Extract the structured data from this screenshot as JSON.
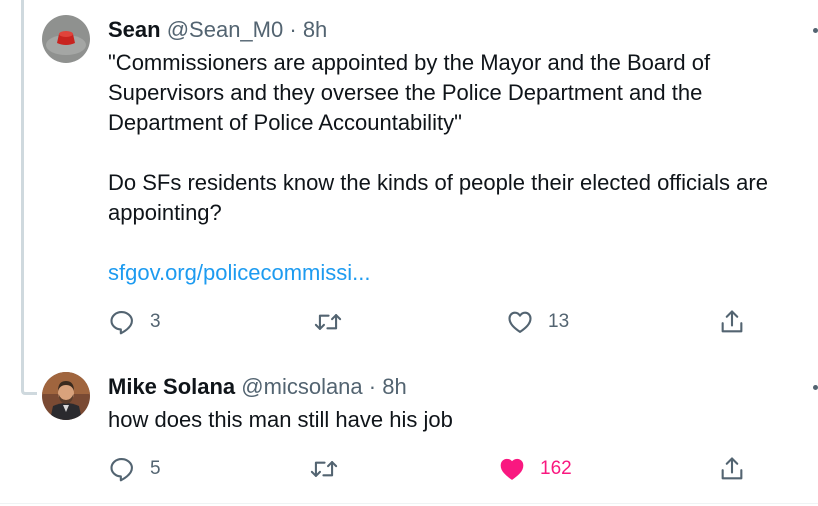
{
  "tweets": [
    {
      "display_name": "Sean",
      "handle": "@Sean_M0",
      "separator": "·",
      "time": "8h",
      "text_1": "\"Commissioners are appointed by the Mayor and the Board of Supervisors and they oversee the Police Department and the Department of Police Accountability\"",
      "text_2": "Do SFs residents know the kinds of people their elected officials are appointing?",
      "link": "sfgov.org/policecommissi...",
      "reply_count": "3",
      "retweet_count": "",
      "like_count": "13",
      "liked": false
    },
    {
      "display_name": "Mike Solana",
      "handle": "@micsolana",
      "separator": "·",
      "time": "8h",
      "text_1": "how does this man still have his job",
      "reply_count": "5",
      "retweet_count": "",
      "like_count": "162",
      "liked": true
    }
  ],
  "icons": {
    "reply": "reply-icon",
    "retweet": "retweet-icon",
    "like": "heart-icon",
    "share": "share-icon",
    "more": "more-icon"
  },
  "colors": {
    "link": "#1d9bf0",
    "liked": "#f91880",
    "muted": "#536471",
    "thread_line": "#cfd9de"
  }
}
